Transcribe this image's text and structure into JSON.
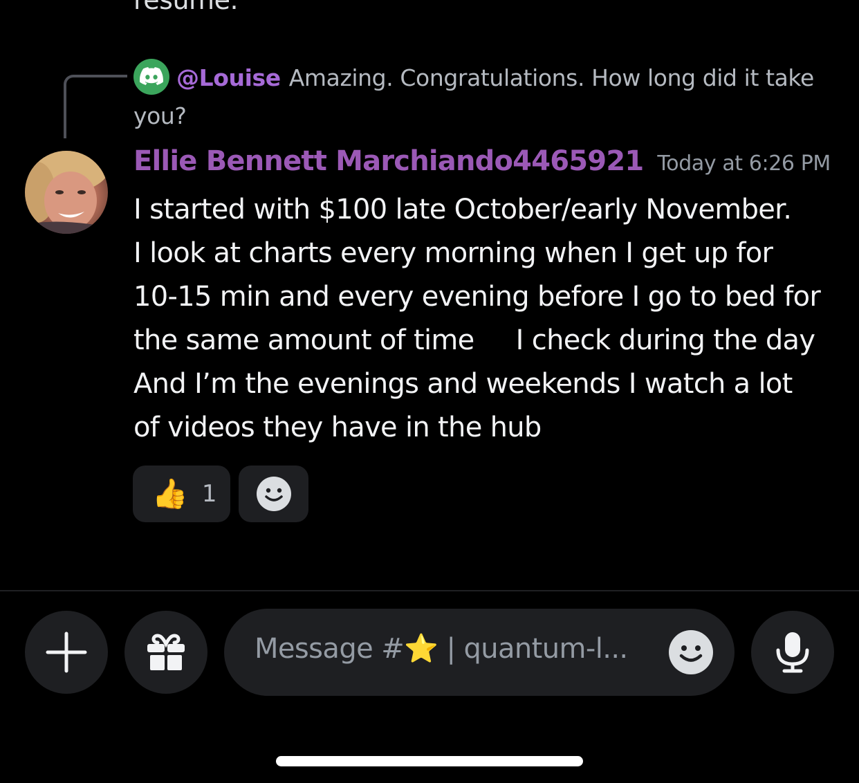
{
  "previous_message_tail": "resume.",
  "reply": {
    "mention": "@Louise",
    "text": "Amazing. Congratulations. How long did it take you?",
    "avatar_icon": "discord-icon",
    "avatar_color": "#3ba55c"
  },
  "message": {
    "author": "Ellie Bennett Marchiando4465921",
    "author_color": "#9b59b6",
    "timestamp": "Today at 6:26 PM",
    "lines": [
      "I started with $100 late October/early November.",
      "I look at charts every morning when I get up for",
      "10-15 min and every evening before I go to bed for",
      "the same amount of time     I check during the day",
      "And I’m the evenings and weekends I watch a lot",
      "of videos they have in the hub"
    ]
  },
  "reactions": [
    {
      "emoji": "👍",
      "count": "1"
    }
  ],
  "add_reaction_icon": "smiley-icon",
  "composer": {
    "placeholder": "Message #⭐ | quantum-l...",
    "buttons": [
      "plus-icon",
      "gift-icon",
      "smiley-icon",
      "microphone-icon"
    ]
  }
}
